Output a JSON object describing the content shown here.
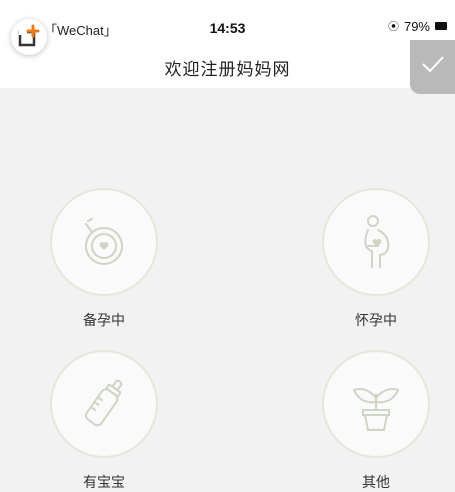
{
  "status_bar": {
    "back_app": "「WeChat」",
    "time": "14:53",
    "battery": "79%"
  },
  "header": {
    "title": "欢迎注册妈妈网"
  },
  "options": [
    {
      "label": "备孕中",
      "icon": "pregnancy-test-icon"
    },
    {
      "label": "怀孕中",
      "icon": "pregnant-woman-icon"
    },
    {
      "label": "有宝宝",
      "icon": "baby-bottle-icon"
    },
    {
      "label": "其他",
      "icon": "plant-pot-icon"
    }
  ],
  "colors": {
    "icon_stroke": "#cfd5c5",
    "circle_border": "#e4e8da"
  }
}
